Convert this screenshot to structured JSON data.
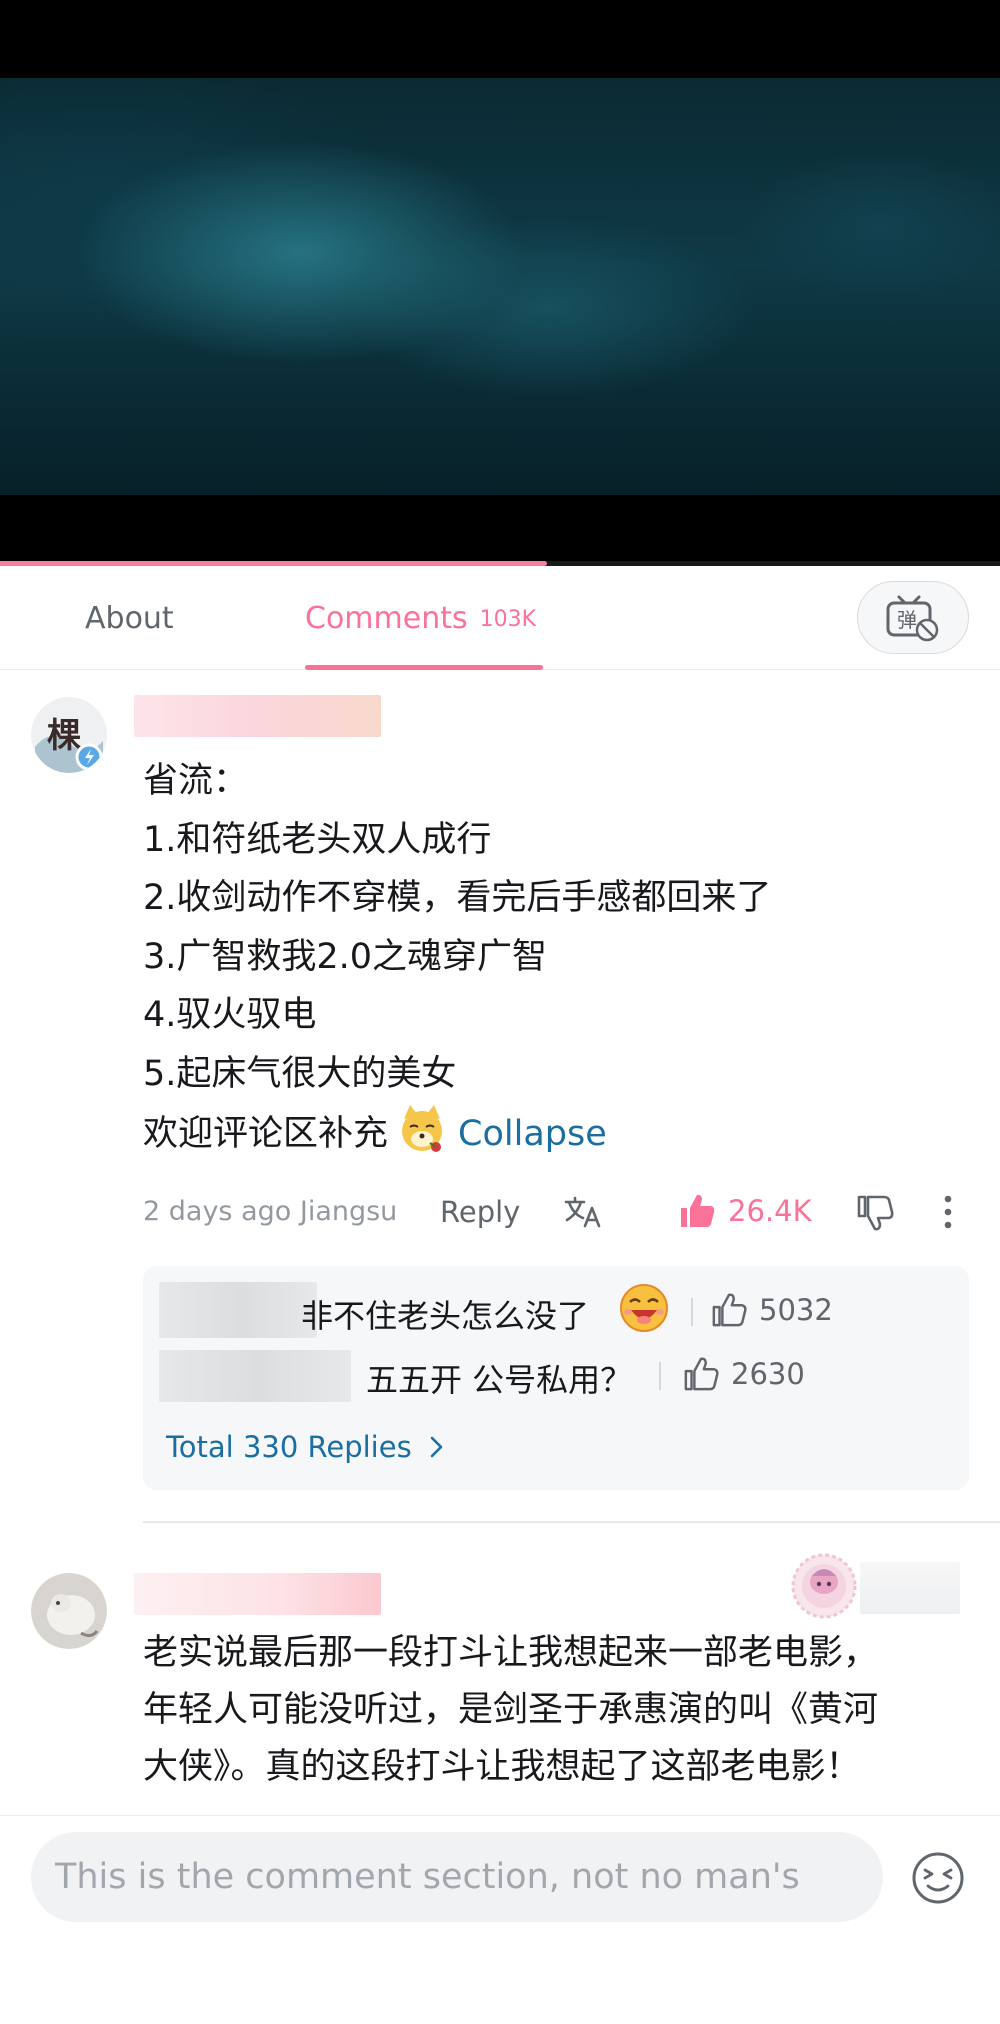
{
  "video": {
    "progress": 0.547
  },
  "tabs": {
    "about": "About",
    "comments": "Comments",
    "comments_count": "103K",
    "danmaku_icon": "danmaku-toggle-icon",
    "danmaku_glyph": "弹"
  },
  "comment1": {
    "avatar_text": "棵",
    "lines": [
      "省流：",
      "1.和符纸老头双人成行",
      "2.收剑动作不穿模，看完后手感都回来了",
      "3.广智救我2.0之魂穿广智",
      "4.驭火驭电",
      "5.起床气很大的美女",
      "欢迎评论区补充"
    ],
    "collapse": "Collapse",
    "time_location": "2 days ago Jiangsu",
    "reply": "Reply",
    "likes": "26.4K",
    "replies": [
      {
        "text": "非不住老头怎么没了",
        "likes": "5032"
      },
      {
        "text": "五五开  公号私用？",
        "likes": "2630"
      }
    ],
    "total_replies": "Total 330 Replies"
  },
  "comment2": {
    "lines": [
      "老实说最后那一段打斗让我想起来一部老电影，",
      "年轻人可能没听过，是剑圣于承惠演的叫《黄河",
      "大侠》。真的这段打斗让我想起了这部老电影！"
    ]
  },
  "input": {
    "placeholder": "This is the comment section, not no man's"
  },
  "colors": {
    "accent": "#fb7299",
    "link": "#1b6ea0"
  }
}
